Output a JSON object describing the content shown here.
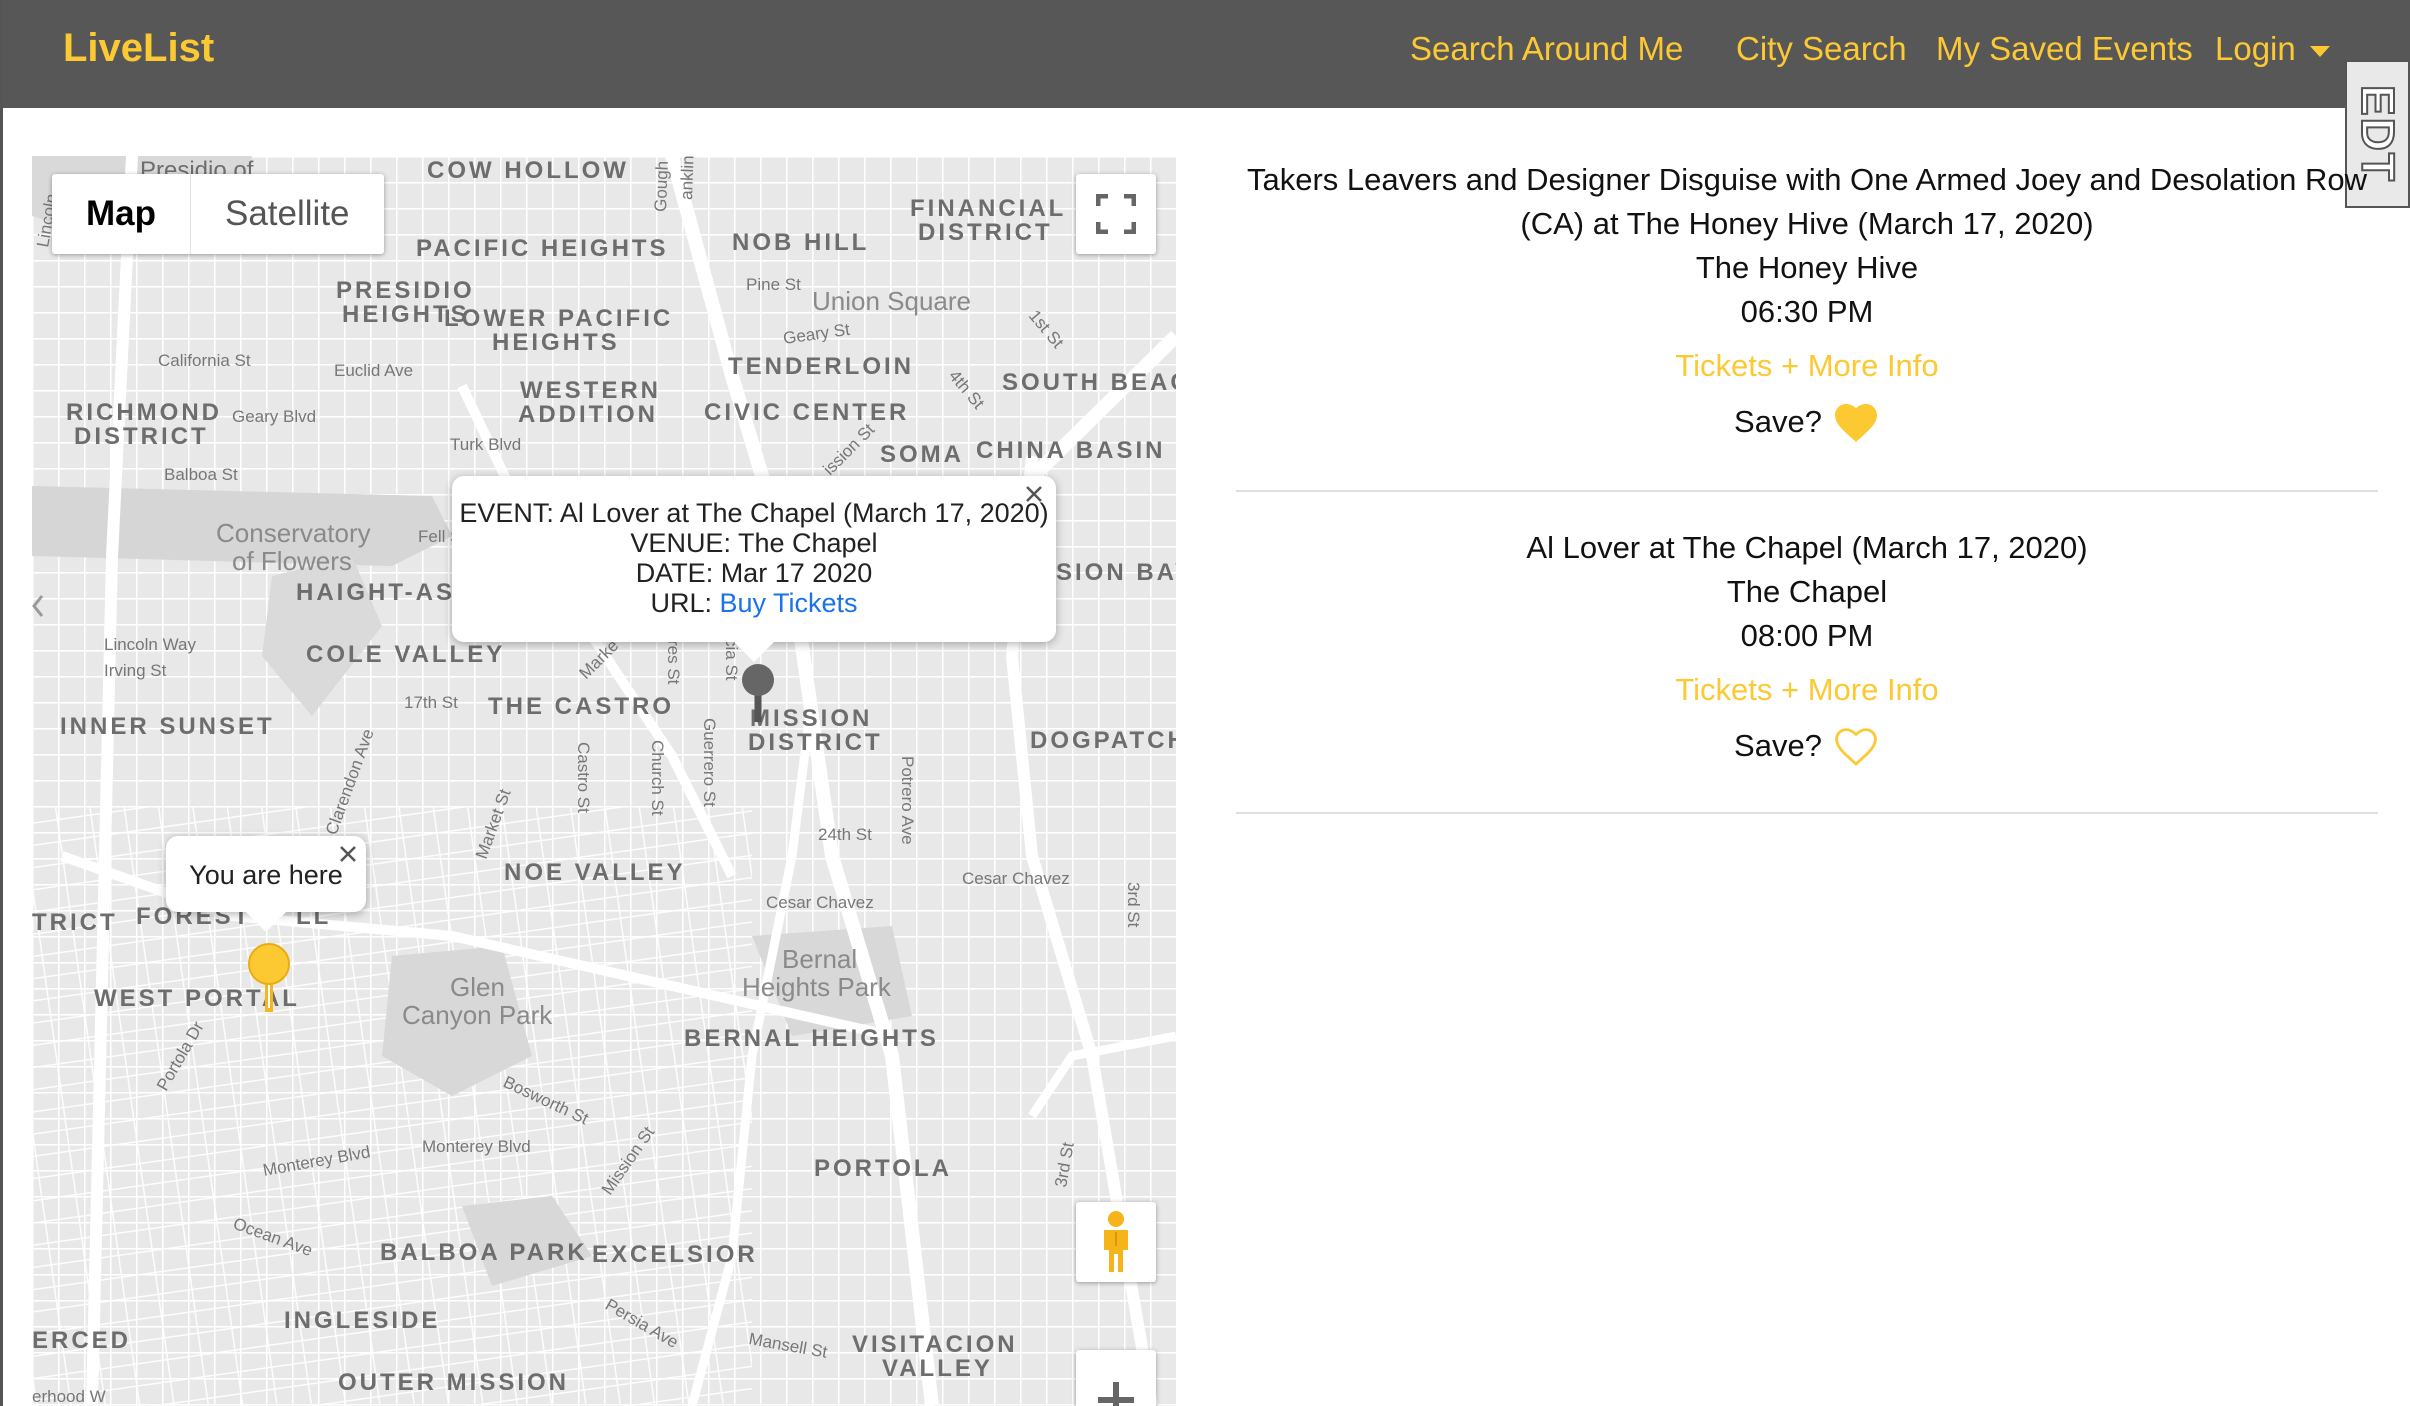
{
  "navbar": {
    "brand": "LiveList",
    "links": [
      "Search Around Me",
      "City Search",
      "My Saved Events",
      "Login"
    ],
    "accent_color": "#fcc933",
    "background_color": "#575757"
  },
  "side_widget": {
    "label": "EDT"
  },
  "map": {
    "type_controls": {
      "map_label": "Map",
      "satellite_label": "Satellite",
      "selected": "Map"
    },
    "controls": [
      "fullscreen-icon",
      "pegman-icon",
      "zoom-in-icon"
    ],
    "event_info_window": {
      "event_line": "EVENT: Al Lover at The Chapel (March 17, 2020)",
      "venue_line": "VENUE: The Chapel",
      "date_line": "DATE: Mar 17 2020",
      "url_prefix": "URL:",
      "url_link_text": "Buy Tickets"
    },
    "user_info_window": {
      "text": "You are here"
    },
    "labels": [
      "Presidio of",
      "COW HOLLOW",
      "FINANCIAL",
      "DISTRICT",
      "NOB HILL",
      "PACIFIC HEIGHTS",
      "Union Square",
      "PRESIDIO",
      "HEIGHTS",
      "LOWER PACIFIC",
      "HEIGHTS",
      "TENDERLOIN",
      "SOUTH BEAC",
      "RICHMOND",
      "DISTRICT",
      "WESTERN",
      "ADDITION",
      "CIVIC CENTER",
      "SOMA",
      "CHINA BASIN",
      "Conservatory",
      "of Flowers",
      "HAIGHT-AS",
      "SION BAY",
      "COLE VALLEY",
      "THE CASTRO",
      "MISSION",
      "DISTRICT",
      "INNER SUNSET",
      "DOGPATCH",
      "NOE VALLEY",
      "FOREST",
      "LL",
      "TRICT",
      "WEST PORTAL",
      "Glen",
      "Canyon Park",
      "Bernal",
      "Heights Park",
      "BERNAL HEIGHTS",
      "PORTOLA",
      "BALBOA PARK",
      "EXCELSIOR",
      "INGLESIDE",
      "VISITACION",
      "VALLEY",
      "ERCED",
      "OUTER MISSION",
      "California St",
      "Euclid Ave",
      "Geary Blvd",
      "Balboa St",
      "Turk Blvd",
      "Fell St",
      "Lincoln Way",
      "Irving St",
      "17th St",
      "Castro St",
      "Church St",
      "Guerrero St",
      "Potrero Ave",
      "24th St",
      "Cesar Chavez",
      "Cesar Chavez",
      "3rd St",
      "Market St",
      "Clarendon Ave",
      "Portola Dr",
      "Bosworth St",
      "Monterey Blvd",
      "Monterey Blvd",
      "Mission St",
      "Ocean Ave",
      "Persia Ave",
      "Mansell St",
      "3rd St",
      "Pine St",
      "Geary St",
      "4th St",
      "1st St",
      "Gough St",
      "anklin St",
      "Lincoln",
      "ission St",
      "Marke",
      "res St",
      "cia St",
      "erhood W"
    ]
  },
  "events": [
    {
      "title": "Takers Leavers and Designer Disguise with One Armed Joey and Desolation Row (CA) at The Honey Hive (March 17, 2020)",
      "venue": "The Honey Hive",
      "time": "06:30 PM",
      "tickets_label": "Tickets + More Info",
      "save_label": "Save?",
      "saved": true
    },
    {
      "title": "Al Lover at The Chapel (March 17, 2020)",
      "venue": "The Chapel",
      "time": "08:00 PM",
      "tickets_label": "Tickets + More Info",
      "save_label": "Save?",
      "saved": false
    }
  ]
}
